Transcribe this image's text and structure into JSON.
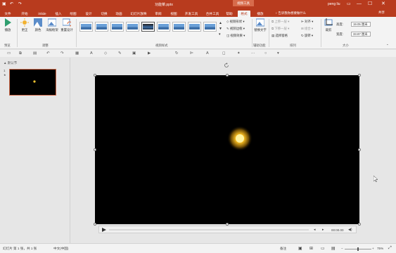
{
  "titlebar": {
    "filename": "功能菜.pptx",
    "tools": "视频工具",
    "user": "peng liu",
    "min": "—",
    "max": "☐",
    "close": "✕"
  },
  "tabs": [
    "文件",
    "开始",
    "iSlide",
    "插入",
    "绘图",
    "设计",
    "切换",
    "动画",
    "幻灯片放映",
    "审阅",
    "视图",
    "开发工具",
    "合并工具",
    "帮助",
    "格式",
    "播放"
  ],
  "tellme": "♀ 告诉我你想要做什么",
  "share": "共享",
  "ribbon": {
    "play_label": "播放",
    "preview_group": "预览",
    "correct_label": "更正",
    "color_label": "颜色",
    "poster_label": "海报框架",
    "reset_label": "重置设计",
    "adjust_group": "调整",
    "styles_group": "视频样式",
    "shape_label": "视频形状",
    "border_label": "视频边框",
    "effect_label": "视频效果",
    "alt_text_label": "替换文字",
    "accessibility_group": "辅助功能",
    "forward_label": "上移一层",
    "backward_label": "下移一层",
    "select_pane_label": "选择窗格",
    "align_label": "对齐",
    "group_label": "组合",
    "rotate_label": "旋转",
    "arrange_group": "排列",
    "crop_label": "裁剪",
    "height_label": "高度:",
    "height_value": "19.05 厘米",
    "width_label": "宽度:",
    "width_value": "33.87 厘米",
    "size_group": "大小"
  },
  "slide_pane": {
    "section": "▲ 默认节",
    "slide_number": "1",
    "slide_star": "★"
  },
  "playbar": {
    "time": "00:00.00"
  },
  "status": {
    "slide_info": "幻灯片 第 1 张，共 1 张",
    "language": "中文(中国)",
    "notes": "备注",
    "zoom": "75%"
  }
}
